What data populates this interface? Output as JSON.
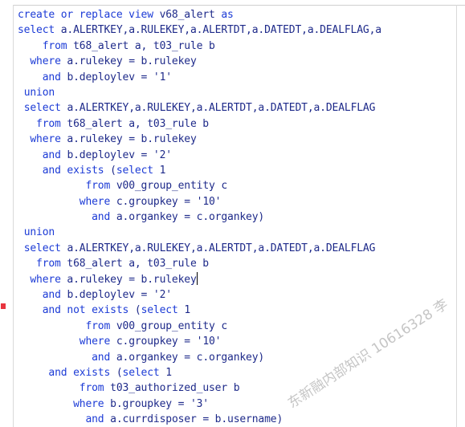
{
  "editor": {
    "lines": [
      {
        "indent": "",
        "tokens": [
          {
            "t": "create or replace view ",
            "c": "kw"
          },
          {
            "t": "v68_alert ",
            "c": "id"
          },
          {
            "t": "as",
            "c": "kw"
          }
        ]
      },
      {
        "indent": "",
        "tokens": [
          {
            "t": "select ",
            "c": "kw"
          },
          {
            "t": "a.ALERTKEY,a.RULEKEY,a.ALERTDT,a.DATEDT,a.DEALFLAG,a",
            "c": "id"
          }
        ]
      },
      {
        "indent": "    ",
        "tokens": [
          {
            "t": "from ",
            "c": "kw"
          },
          {
            "t": "t68_alert a, t03_rule b",
            "c": "id"
          }
        ]
      },
      {
        "indent": "  ",
        "tokens": [
          {
            "t": "where ",
            "c": "kw"
          },
          {
            "t": "a.rulekey = b.rulekey",
            "c": "id"
          }
        ]
      },
      {
        "indent": "    ",
        "tokens": [
          {
            "t": "and ",
            "c": "kw"
          },
          {
            "t": "b.deploylev = '1'",
            "c": "id"
          }
        ]
      },
      {
        "indent": " ",
        "tokens": [
          {
            "t": "union",
            "c": "kw"
          }
        ]
      },
      {
        "indent": " ",
        "tokens": [
          {
            "t": "select ",
            "c": "kw"
          },
          {
            "t": "a.ALERTKEY,a.RULEKEY,a.ALERTDT,a.DATEDT,a.DEALFLAG",
            "c": "id"
          }
        ]
      },
      {
        "indent": "   ",
        "tokens": [
          {
            "t": "from ",
            "c": "kw"
          },
          {
            "t": "t68_alert a, t03_rule b",
            "c": "id"
          }
        ]
      },
      {
        "indent": "  ",
        "tokens": [
          {
            "t": "where ",
            "c": "kw"
          },
          {
            "t": "a.rulekey = b.rulekey",
            "c": "id"
          }
        ]
      },
      {
        "indent": "    ",
        "tokens": [
          {
            "t": "and ",
            "c": "kw"
          },
          {
            "t": "b.deploylev = '2'",
            "c": "id"
          }
        ]
      },
      {
        "indent": "    ",
        "tokens": [
          {
            "t": "and exists ",
            "c": "kw"
          },
          {
            "t": "(",
            "c": "id"
          },
          {
            "t": "select ",
            "c": "kw"
          },
          {
            "t": "1",
            "c": "id"
          }
        ]
      },
      {
        "indent": "           ",
        "tokens": [
          {
            "t": "from ",
            "c": "kw"
          },
          {
            "t": "v00_group_entity c",
            "c": "id"
          }
        ]
      },
      {
        "indent": "          ",
        "tokens": [
          {
            "t": "where ",
            "c": "kw"
          },
          {
            "t": "c.groupkey = '10'",
            "c": "id"
          }
        ]
      },
      {
        "indent": "            ",
        "tokens": [
          {
            "t": "and ",
            "c": "kw"
          },
          {
            "t": "a.organkey = c.organkey)",
            "c": "id"
          }
        ]
      },
      {
        "indent": " ",
        "tokens": [
          {
            "t": "union",
            "c": "kw"
          }
        ]
      },
      {
        "indent": " ",
        "tokens": [
          {
            "t": "select ",
            "c": "kw"
          },
          {
            "t": "a.ALERTKEY,a.RULEKEY,a.ALERTDT,a.DATEDT,a.DEALFLAG",
            "c": "id"
          }
        ]
      },
      {
        "indent": "   ",
        "tokens": [
          {
            "t": "from ",
            "c": "kw"
          },
          {
            "t": "t68_alert a, t03_rule b",
            "c": "id"
          }
        ]
      },
      {
        "indent": "  ",
        "tokens": [
          {
            "t": "where ",
            "c": "kw"
          },
          {
            "t": "a.rulekey = b.rulekey",
            "c": "id"
          }
        ],
        "cursor": true
      },
      {
        "indent": "    ",
        "tokens": [
          {
            "t": "and ",
            "c": "kw"
          },
          {
            "t": "b.deploylev = '2'",
            "c": "id"
          }
        ]
      },
      {
        "indent": "    ",
        "tokens": [
          {
            "t": "and not exists ",
            "c": "kw"
          },
          {
            "t": "(",
            "c": "id"
          },
          {
            "t": "select ",
            "c": "kw"
          },
          {
            "t": "1",
            "c": "id"
          }
        ]
      },
      {
        "indent": "           ",
        "tokens": [
          {
            "t": "from ",
            "c": "kw"
          },
          {
            "t": "v00_group_entity c",
            "c": "id"
          }
        ]
      },
      {
        "indent": "          ",
        "tokens": [
          {
            "t": "where ",
            "c": "kw"
          },
          {
            "t": "c.groupkey = '10'",
            "c": "id"
          }
        ]
      },
      {
        "indent": "            ",
        "tokens": [
          {
            "t": "and ",
            "c": "kw"
          },
          {
            "t": "a.organkey = c.organkey)",
            "c": "id"
          }
        ]
      },
      {
        "indent": "     ",
        "tokens": [
          {
            "t": "and exists ",
            "c": "kw"
          },
          {
            "t": "(",
            "c": "id"
          },
          {
            "t": "select ",
            "c": "kw"
          },
          {
            "t": "1",
            "c": "id"
          }
        ]
      },
      {
        "indent": "          ",
        "tokens": [
          {
            "t": "from ",
            "c": "kw"
          },
          {
            "t": "t03_authorized_user b",
            "c": "id"
          }
        ]
      },
      {
        "indent": "         ",
        "tokens": [
          {
            "t": "where ",
            "c": "kw"
          },
          {
            "t": "b.groupkey = '3'",
            "c": "id"
          }
        ]
      },
      {
        "indent": "           ",
        "tokens": [
          {
            "t": "and ",
            "c": "kw"
          },
          {
            "t": "a.currdisposer = b.username)",
            "c": "id"
          }
        ]
      }
    ]
  },
  "watermark": {
    "text": "东新融内部知识 10616328 李"
  },
  "colors": {
    "keyword": "#1c3bd6",
    "identifier": "#1e2a8a",
    "bookmark": "#e8343f",
    "background": "#ffffff"
  }
}
